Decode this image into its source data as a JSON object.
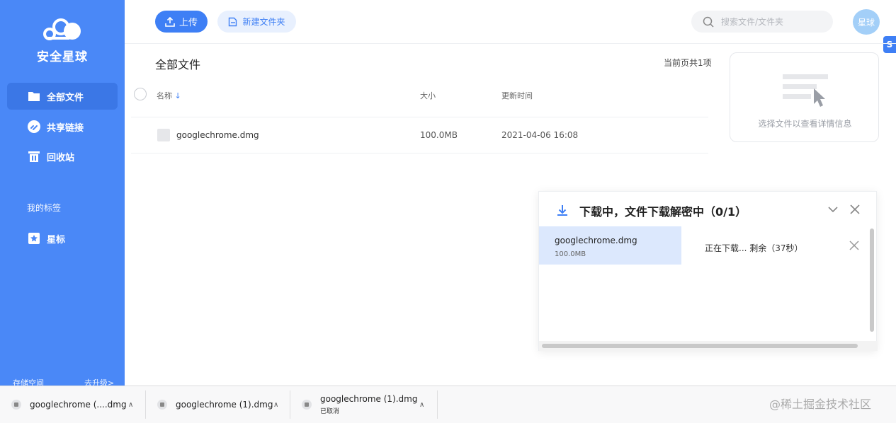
{
  "app": {
    "name": "安全星球"
  },
  "sidebar": {
    "items": [
      {
        "label": "全部文件",
        "icon": "folder-icon",
        "active": true
      },
      {
        "label": "共享链接",
        "icon": "link-icon",
        "active": false
      },
      {
        "label": "回收站",
        "icon": "trash-icon",
        "active": false
      }
    ],
    "tags_title": "我的标签",
    "tags": [
      {
        "label": "星标",
        "icon": "star-icon"
      }
    ],
    "storage_label": "存储空间",
    "upgrade_label": "去升级>"
  },
  "toolbar": {
    "upload_label": "上传",
    "new_folder_label": "新建文件夹",
    "search_placeholder": "搜索文件/文件夹",
    "avatar_text": "星球",
    "side_badge": "S"
  },
  "file_list": {
    "title": "全部文件",
    "count_text": "当前页共1项",
    "columns": {
      "name": "名称",
      "sort_arrow": "↓",
      "size": "大小",
      "updated": "更新时间"
    },
    "rows": [
      {
        "name": "googlechrome.dmg",
        "size": "100.0MB",
        "updated": "2021-04-06 16:08"
      }
    ]
  },
  "detail_panel": {
    "text": "选择文件以查看详情信息"
  },
  "download_panel": {
    "title": "下载中，文件下载解密中（0/1）",
    "item": {
      "name": "googlechrome.dmg",
      "size": "100.0MB",
      "status": "正在下载... 剩余（37秒）"
    }
  },
  "browser_downloads": [
    {
      "name": "googlechrome (....dmg",
      "status": ""
    },
    {
      "name": "googlechrome (1).dmg",
      "status": ""
    },
    {
      "name": "googlechrome (1).dmg",
      "status": "已取消"
    }
  ],
  "watermark": "@稀土掘金技术社区",
  "colors": {
    "brand": "#4a88f7",
    "primary": "#3e7ff5",
    "active_nav": "#3b77e6",
    "selected_row": "#dce8fd"
  }
}
